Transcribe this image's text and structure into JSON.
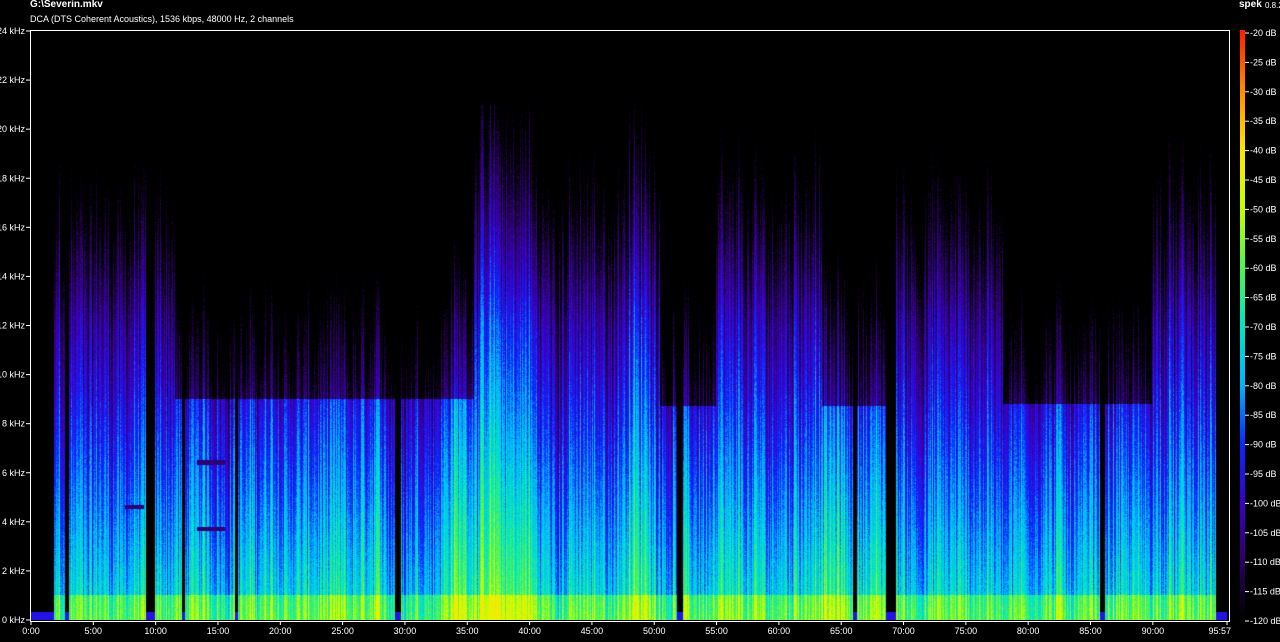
{
  "file_title": "G:\\Severin.mkv",
  "stream_info": "DCA (DTS Coherent Acoustics), 1536 kbps, 48000 Hz, 2 channels",
  "app_name": "spek",
  "app_version": "0.8.2",
  "chart_data": {
    "type": "heatmap",
    "title": "G:\\Severin.mkv",
    "subtitle": "DCA (DTS Coherent Acoustics), 1536 kbps, 48000 Hz, 2 channels",
    "xlabel": "",
    "ylabel": "",
    "x_ticks": [
      "0:00",
      "5:00",
      "10:00",
      "15:00",
      "20:00",
      "25:00",
      "30:00",
      "35:00",
      "40:00",
      "45:00",
      "50:00",
      "55:00",
      "60:00",
      "65:00",
      "70:00",
      "75:00",
      "80:00",
      "85:00",
      "90:00",
      "95:57"
    ],
    "x_tick_values_min": [
      0,
      5,
      10,
      15,
      20,
      25,
      30,
      35,
      40,
      45,
      50,
      55,
      60,
      65,
      70,
      75,
      80,
      85,
      90,
      95.95
    ],
    "y_ticks": [
      "0 kHz",
      "2 kHz",
      "4 kHz",
      "6 kHz",
      "8 kHz",
      "10 kHz",
      "12 kHz",
      "14 kHz",
      "16 kHz",
      "18 kHz",
      "20 kHz",
      "22 kHz",
      "24 kHz"
    ],
    "y_tick_values_khz": [
      0,
      2,
      4,
      6,
      8,
      10,
      12,
      14,
      16,
      18,
      20,
      22,
      24
    ],
    "xlim_min": [
      0,
      95.95
    ],
    "ylim_khz": [
      0,
      24
    ],
    "colorbar_ticks": [
      "-20 dB",
      "-25 dB",
      "-30 dB",
      "-35 dB",
      "-40 dB",
      "-45 dB",
      "-50 dB",
      "-55 dB",
      "-60 dB",
      "-65 dB",
      "-70 dB",
      "-75 dB",
      "-80 dB",
      "-85 dB",
      "-90 dB",
      "-95 dB",
      "-100 dB",
      "-105 dB",
      "-110 dB",
      "-115 dB",
      "-120 dB"
    ],
    "colorbar_range_db": [
      -120,
      -20
    ],
    "colormap": [
      "#000000",
      "#2b0063",
      "#3c00c8",
      "#0a28ff",
      "#00b4ff",
      "#00e6c8",
      "#50f550",
      "#c8ff00",
      "#ffe600",
      "#ff8c00",
      "#ff1e00"
    ],
    "audio_start_min": 1.8,
    "audio_end_min": 95.1,
    "lowpass_cutoff_khz": 21,
    "silent_gaps_min": [
      [
        2.7,
        3.0
      ],
      [
        9.2,
        9.9
      ],
      [
        12.1,
        12.3
      ],
      [
        16.3,
        16.6
      ],
      [
        29.2,
        29.7
      ],
      [
        51.8,
        52.3
      ],
      [
        66.0,
        66.3
      ],
      [
        68.6,
        69.4
      ],
      [
        85.8,
        86.2
      ]
    ],
    "dark_band_segments": [
      {
        "from_min": 11.5,
        "to_min": 35.5,
        "cutoff_khz": 9.0
      },
      {
        "from_min": 50.5,
        "to_min": 55.0,
        "cutoff_khz": 8.7
      },
      {
        "from_min": 63.5,
        "to_min": 69.0,
        "cutoff_khz": 8.7
      },
      {
        "from_min": 78.0,
        "to_min": 90.0,
        "cutoff_khz": 8.8
      }
    ],
    "tonal_lines": [
      {
        "from_min": 13.3,
        "to_min": 15.5,
        "freq_khz": 6.4
      },
      {
        "from_min": 13.3,
        "to_min": 15.5,
        "freq_khz": 3.7
      },
      {
        "from_min": 7.5,
        "to_min": 9.0,
        "freq_khz": 4.6
      }
    ]
  }
}
